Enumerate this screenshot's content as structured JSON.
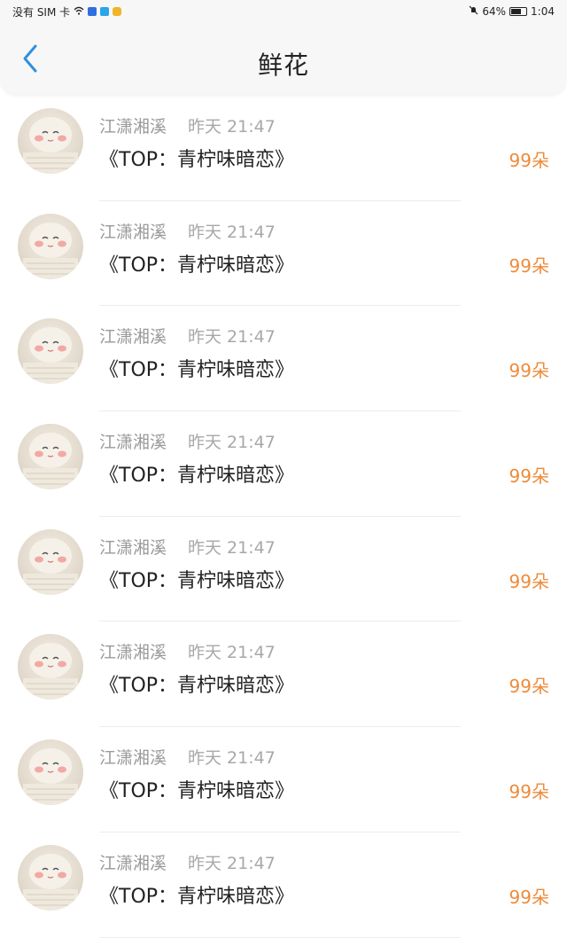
{
  "status_bar": {
    "carrier": "没有 SIM 卡",
    "battery": "64%",
    "time": "1:04"
  },
  "header": {
    "title": "鲜花",
    "back_icon": "chevron-left-icon",
    "accent_color": "#2f8fe0"
  },
  "colors": {
    "count": "#ee8b3a",
    "name": "#9a9a9a"
  },
  "records": [
    {
      "name": "江潇湘溪",
      "time": "昨天 21:47",
      "title": "《TOP：青柠味暗恋》",
      "count": "99朵"
    },
    {
      "name": "江潇湘溪",
      "time": "昨天 21:47",
      "title": "《TOP：青柠味暗恋》",
      "count": "99朵"
    },
    {
      "name": "江潇湘溪",
      "time": "昨天 21:47",
      "title": "《TOP：青柠味暗恋》",
      "count": "99朵"
    },
    {
      "name": "江潇湘溪",
      "time": "昨天 21:47",
      "title": "《TOP：青柠味暗恋》",
      "count": "99朵"
    },
    {
      "name": "江潇湘溪",
      "time": "昨天 21:47",
      "title": "《TOP：青柠味暗恋》",
      "count": "99朵"
    },
    {
      "name": "江潇湘溪",
      "time": "昨天 21:47",
      "title": "《TOP：青柠味暗恋》",
      "count": "99朵"
    },
    {
      "name": "江潇湘溪",
      "time": "昨天 21:47",
      "title": "《TOP：青柠味暗恋》",
      "count": "99朵"
    },
    {
      "name": "江潇湘溪",
      "time": "昨天 21:47",
      "title": "《TOP：青柠味暗恋》",
      "count": "99朵"
    }
  ]
}
